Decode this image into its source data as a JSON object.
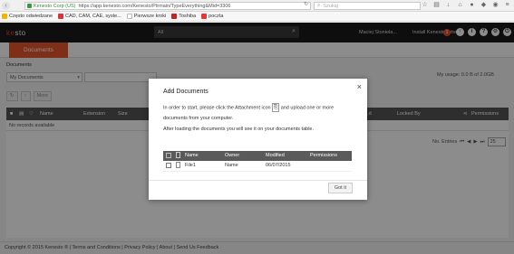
{
  "browser": {
    "org": "Kenesto Corp (US)",
    "url": "https://app.kenesto.com/Kenesto/Ptrmain/TypeEverything&Mid=3306",
    "search_placeholder": "Szukaj",
    "bookmarks": [
      "Często odwiedzane",
      "CAD, CAM, CAE, syste...",
      "Pierwsze kroki",
      "Toshiba",
      "poczta"
    ]
  },
  "app": {
    "logo_prefix": "ke",
    "logo_rest": "sto",
    "global_search": "All",
    "user": "Maciej Stoniela...",
    "drive_label": "Install Kenesto Drive",
    "notifications": "1"
  },
  "tabs": {
    "documents": "Documents"
  },
  "page": {
    "breadcrumb": "Documents",
    "view_select": "My Documents",
    "usage": "My usage: 0.0 B of 2.0GB",
    "toolbar_more": "More",
    "columns_select": "Columns",
    "more_select": "More"
  },
  "grid": {
    "columns": [
      "Name",
      "Extension",
      "Size",
      "...d",
      "Locked By",
      "Permissions"
    ],
    "empty_text": "No records available",
    "pager_label": "No. Entries",
    "page_size": "25"
  },
  "modal": {
    "title": "Add Documents",
    "line1_a": "In order to start, please click the Attachment icon",
    "line1_b": "and upload one or more",
    "line2": "documents from your computer.",
    "line3": "After loading the documents you will see it on your documents table.",
    "table_headers": [
      "Name",
      "Owner",
      "Modified",
      "Permissions"
    ],
    "rows": [
      {
        "name": "File1",
        "owner": "Name",
        "modified": "06/07/2015",
        "permissions": ""
      }
    ],
    "button": "Got it"
  },
  "footer": {
    "text": "Copyright © 2015 Kenesto ® | Terms and Conditions | Privacy Policy | About | Send Us Feedback"
  },
  "colors": {
    "accent": "#e8552c",
    "header": "#1b1b1b",
    "grid_header": "#555555"
  }
}
